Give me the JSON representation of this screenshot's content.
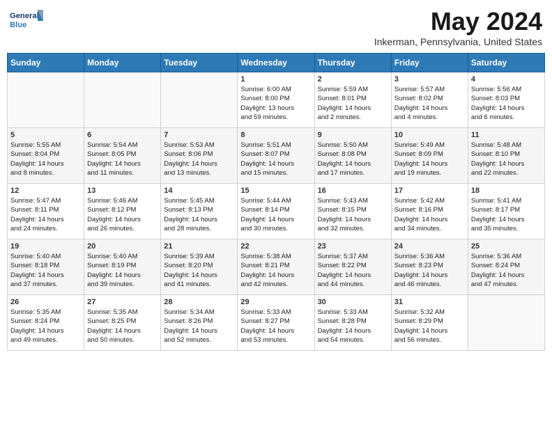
{
  "logo": {
    "general": "General",
    "blue": "Blue"
  },
  "title": "May 2024",
  "location": "Inkerman, Pennsylvania, United States",
  "days_of_week": [
    "Sunday",
    "Monday",
    "Tuesday",
    "Wednesday",
    "Thursday",
    "Friday",
    "Saturday"
  ],
  "weeks": [
    [
      {
        "day": "",
        "info": ""
      },
      {
        "day": "",
        "info": ""
      },
      {
        "day": "",
        "info": ""
      },
      {
        "day": "1",
        "info": "Sunrise: 6:00 AM\nSunset: 8:00 PM\nDaylight: 13 hours\nand 59 minutes."
      },
      {
        "day": "2",
        "info": "Sunrise: 5:59 AM\nSunset: 8:01 PM\nDaylight: 14 hours\nand 2 minutes."
      },
      {
        "day": "3",
        "info": "Sunrise: 5:57 AM\nSunset: 8:02 PM\nDaylight: 14 hours\nand 4 minutes."
      },
      {
        "day": "4",
        "info": "Sunrise: 5:56 AM\nSunset: 8:03 PM\nDaylight: 14 hours\nand 6 minutes."
      }
    ],
    [
      {
        "day": "5",
        "info": "Sunrise: 5:55 AM\nSunset: 8:04 PM\nDaylight: 14 hours\nand 8 minutes."
      },
      {
        "day": "6",
        "info": "Sunrise: 5:54 AM\nSunset: 8:05 PM\nDaylight: 14 hours\nand 11 minutes."
      },
      {
        "day": "7",
        "info": "Sunrise: 5:53 AM\nSunset: 8:06 PM\nDaylight: 14 hours\nand 13 minutes."
      },
      {
        "day": "8",
        "info": "Sunrise: 5:51 AM\nSunset: 8:07 PM\nDaylight: 14 hours\nand 15 minutes."
      },
      {
        "day": "9",
        "info": "Sunrise: 5:50 AM\nSunset: 8:08 PM\nDaylight: 14 hours\nand 17 minutes."
      },
      {
        "day": "10",
        "info": "Sunrise: 5:49 AM\nSunset: 8:09 PM\nDaylight: 14 hours\nand 19 minutes."
      },
      {
        "day": "11",
        "info": "Sunrise: 5:48 AM\nSunset: 8:10 PM\nDaylight: 14 hours\nand 22 minutes."
      }
    ],
    [
      {
        "day": "12",
        "info": "Sunrise: 5:47 AM\nSunset: 8:11 PM\nDaylight: 14 hours\nand 24 minutes."
      },
      {
        "day": "13",
        "info": "Sunrise: 5:46 AM\nSunset: 8:12 PM\nDaylight: 14 hours\nand 26 minutes."
      },
      {
        "day": "14",
        "info": "Sunrise: 5:45 AM\nSunset: 8:13 PM\nDaylight: 14 hours\nand 28 minutes."
      },
      {
        "day": "15",
        "info": "Sunrise: 5:44 AM\nSunset: 8:14 PM\nDaylight: 14 hours\nand 30 minutes."
      },
      {
        "day": "16",
        "info": "Sunrise: 5:43 AM\nSunset: 8:15 PM\nDaylight: 14 hours\nand 32 minutes."
      },
      {
        "day": "17",
        "info": "Sunrise: 5:42 AM\nSunset: 8:16 PM\nDaylight: 14 hours\nand 34 minutes."
      },
      {
        "day": "18",
        "info": "Sunrise: 5:41 AM\nSunset: 8:17 PM\nDaylight: 14 hours\nand 35 minutes."
      }
    ],
    [
      {
        "day": "19",
        "info": "Sunrise: 5:40 AM\nSunset: 8:18 PM\nDaylight: 14 hours\nand 37 minutes."
      },
      {
        "day": "20",
        "info": "Sunrise: 5:40 AM\nSunset: 8:19 PM\nDaylight: 14 hours\nand 39 minutes."
      },
      {
        "day": "21",
        "info": "Sunrise: 5:39 AM\nSunset: 8:20 PM\nDaylight: 14 hours\nand 41 minutes."
      },
      {
        "day": "22",
        "info": "Sunrise: 5:38 AM\nSunset: 8:21 PM\nDaylight: 14 hours\nand 42 minutes."
      },
      {
        "day": "23",
        "info": "Sunrise: 5:37 AM\nSunset: 8:22 PM\nDaylight: 14 hours\nand 44 minutes."
      },
      {
        "day": "24",
        "info": "Sunrise: 5:36 AM\nSunset: 8:23 PM\nDaylight: 14 hours\nand 46 minutes."
      },
      {
        "day": "25",
        "info": "Sunrise: 5:36 AM\nSunset: 8:24 PM\nDaylight: 14 hours\nand 47 minutes."
      }
    ],
    [
      {
        "day": "26",
        "info": "Sunrise: 5:35 AM\nSunset: 8:24 PM\nDaylight: 14 hours\nand 49 minutes."
      },
      {
        "day": "27",
        "info": "Sunrise: 5:35 AM\nSunset: 8:25 PM\nDaylight: 14 hours\nand 50 minutes."
      },
      {
        "day": "28",
        "info": "Sunrise: 5:34 AM\nSunset: 8:26 PM\nDaylight: 14 hours\nand 52 minutes."
      },
      {
        "day": "29",
        "info": "Sunrise: 5:33 AM\nSunset: 8:27 PM\nDaylight: 14 hours\nand 53 minutes."
      },
      {
        "day": "30",
        "info": "Sunrise: 5:33 AM\nSunset: 8:28 PM\nDaylight: 14 hours\nand 54 minutes."
      },
      {
        "day": "31",
        "info": "Sunrise: 5:32 AM\nSunset: 8:29 PM\nDaylight: 14 hours\nand 56 minutes."
      },
      {
        "day": "",
        "info": ""
      }
    ]
  ]
}
